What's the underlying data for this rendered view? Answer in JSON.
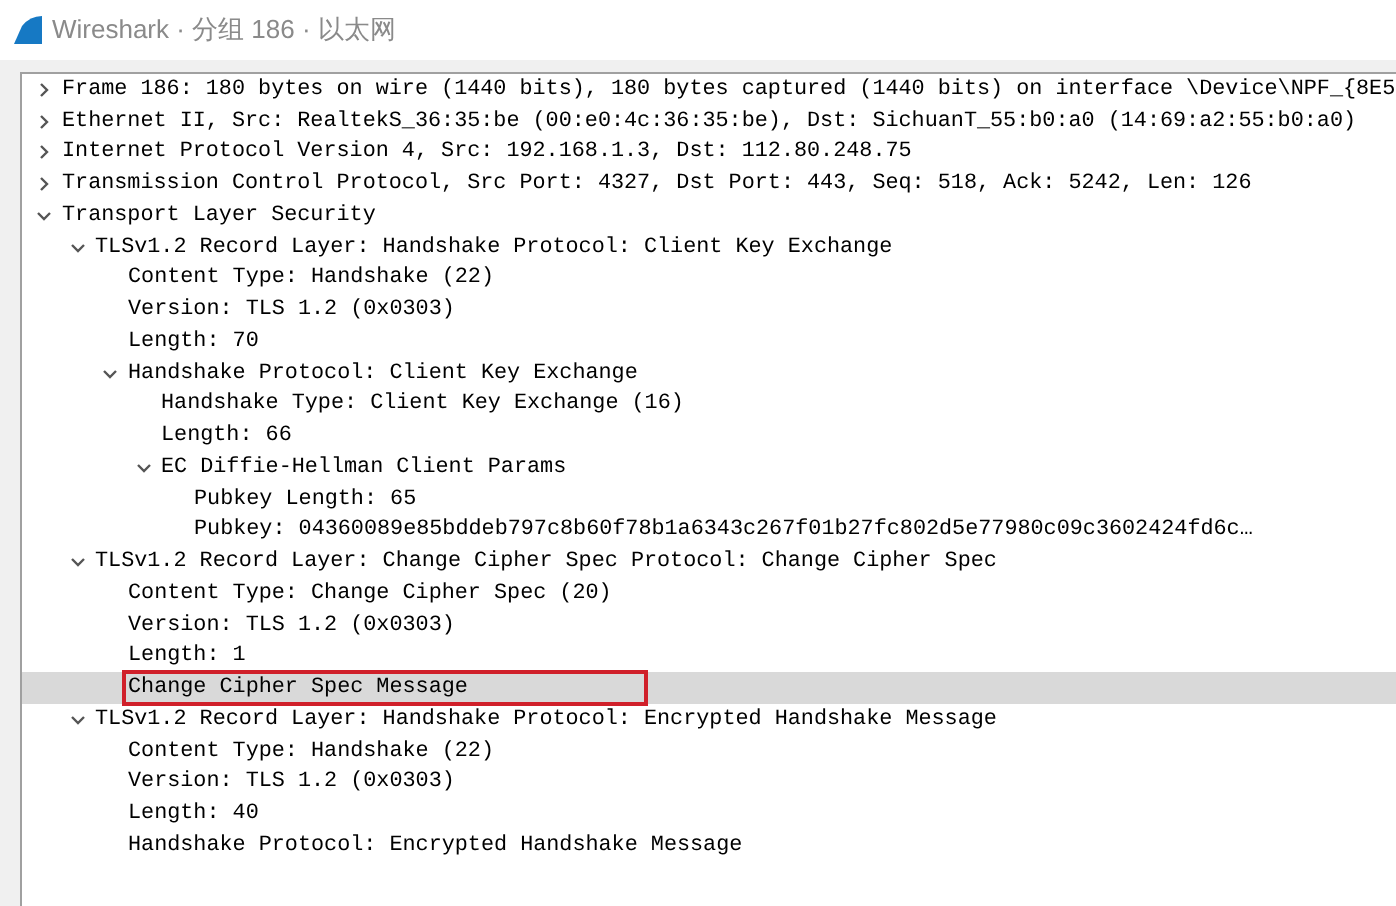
{
  "window": {
    "title": "Wireshark · 分组 186 · 以太网"
  },
  "tree": [
    {
      "label": "Frame 186: 180 bytes on wire (1440 bits), 180 bytes captured (1440 bits) on interface \\Device\\NPF_{8E5",
      "expanded": false,
      "selected": false
    },
    {
      "label": "Ethernet II, Src: RealtekS_36:35:be (00:e0:4c:36:35:be), Dst: SichuanT_55:b0:a0 (14:69:a2:55:b0:a0)",
      "expanded": false,
      "selected": false
    },
    {
      "label": "Internet Protocol Version 4, Src: 192.168.1.3, Dst: 112.80.248.75",
      "expanded": false,
      "selected": false
    },
    {
      "label": "Transmission Control Protocol, Src Port: 4327, Dst Port: 443, Seq: 518, Ack: 5242, Len: 126",
      "expanded": false,
      "selected": false
    },
    {
      "label": "Transport Layer Security",
      "expanded": true,
      "selected": false,
      "children": [
        {
          "label": "TLSv1.2 Record Layer: Handshake Protocol: Client Key Exchange",
          "expanded": true,
          "selected": false,
          "children": [
            {
              "label": "Content Type: Handshake (22)",
              "selected": false
            },
            {
              "label": "Version: TLS 1.2 (0x0303)",
              "selected": false
            },
            {
              "label": "Length: 70",
              "selected": false
            },
            {
              "label": "Handshake Protocol: Client Key Exchange",
              "expanded": true,
              "selected": false,
              "children": [
                {
                  "label": "Handshake Type: Client Key Exchange (16)",
                  "selected": false
                },
                {
                  "label": "Length: 66",
                  "selected": false
                },
                {
                  "label": "EC Diffie-Hellman Client Params",
                  "expanded": true,
                  "selected": false,
                  "children": [
                    {
                      "label": "Pubkey Length: 65",
                      "selected": false
                    },
                    {
                      "label": "Pubkey: 04360089e85bddeb797c8b60f78b1a6343c267f01b27fc802d5e77980c09c3602424fd6c…",
                      "selected": false
                    }
                  ]
                }
              ]
            }
          ]
        },
        {
          "label": "TLSv1.2 Record Layer: Change Cipher Spec Protocol: Change Cipher Spec",
          "expanded": true,
          "selected": false,
          "children": [
            {
              "label": "Content Type: Change Cipher Spec (20)",
              "selected": false
            },
            {
              "label": "Version: TLS 1.2 (0x0303)",
              "selected": false
            },
            {
              "label": "Length: 1",
              "selected": false
            },
            {
              "label": "Change Cipher Spec Message",
              "selected": true,
              "annotated": true
            }
          ]
        },
        {
          "label": "TLSv1.2 Record Layer: Handshake Protocol: Encrypted Handshake Message",
          "expanded": true,
          "selected": false,
          "children": [
            {
              "label": "Content Type: Handshake (22)",
              "selected": false
            },
            {
              "label": "Version: TLS 1.2 (0x0303)",
              "selected": false
            },
            {
              "label": "Length: 40",
              "selected": false
            },
            {
              "label": "Handshake Protocol: Encrypted Handshake Message",
              "selected": false
            }
          ]
        }
      ]
    }
  ]
}
